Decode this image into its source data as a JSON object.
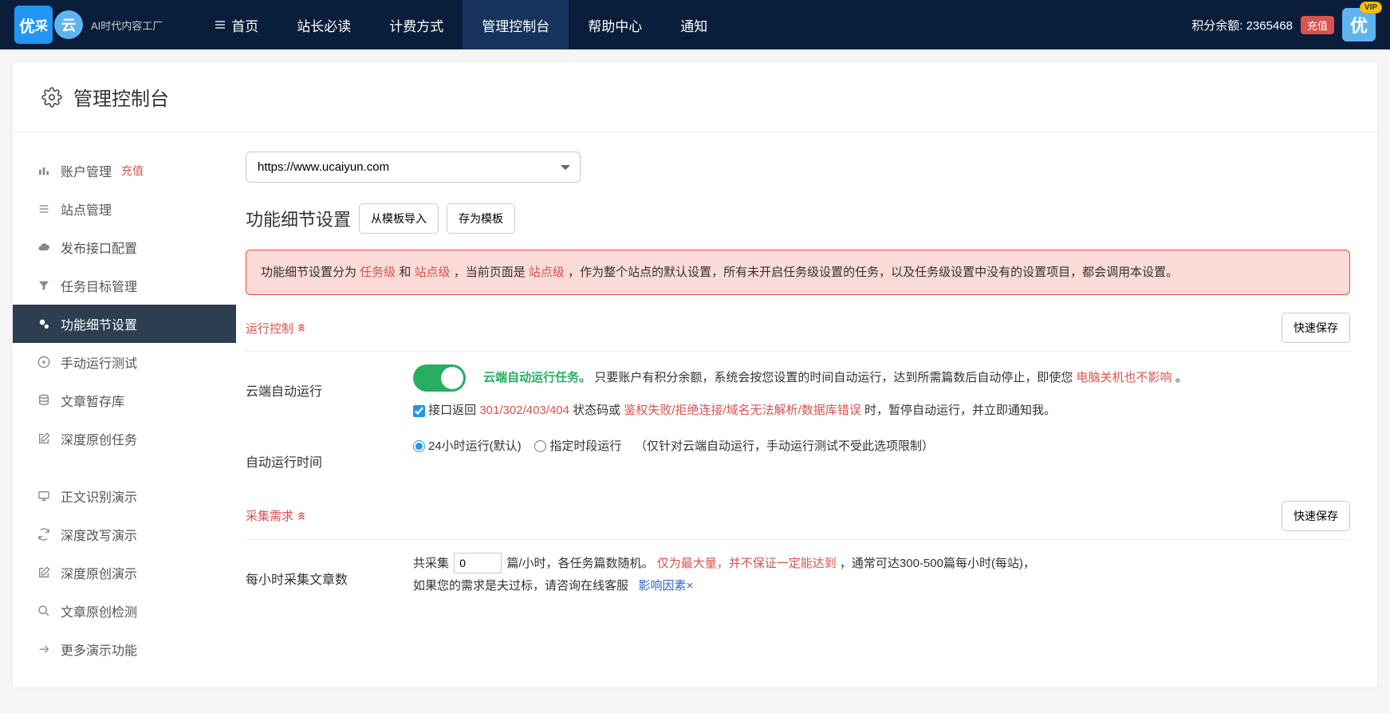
{
  "nav": {
    "logo_main": "优",
    "logo_sub_char": "采",
    "logo_yun": "云",
    "tagline": "AI时代内容工厂",
    "items": [
      {
        "label": "首页",
        "icon": "menu"
      },
      {
        "label": "站长必读"
      },
      {
        "label": "计费方式"
      },
      {
        "label": "管理控制台",
        "active": true
      },
      {
        "label": "帮助中心"
      },
      {
        "label": "通知"
      }
    ],
    "points_label": "积分余额: ",
    "points_value": "2365468",
    "recharge": "充值",
    "user_char": "优",
    "vip": "VIP"
  },
  "panel": {
    "title": "管理控制台"
  },
  "sidebar": {
    "items": [
      {
        "label": "账户管理",
        "badge": "充值",
        "icon": "chart"
      },
      {
        "label": "站点管理",
        "icon": "list"
      },
      {
        "label": "发布接口配置",
        "icon": "cloud"
      },
      {
        "label": "任务目标管理",
        "icon": "filter"
      },
      {
        "label": "功能细节设置",
        "icon": "gears",
        "active": true
      },
      {
        "label": "手动运行测试",
        "icon": "play"
      },
      {
        "label": "文章暂存库",
        "icon": "db"
      },
      {
        "label": "深度原创任务",
        "icon": "edit"
      }
    ],
    "items2": [
      {
        "label": "正文识别演示",
        "icon": "monitor"
      },
      {
        "label": "深度改写演示",
        "icon": "refresh"
      },
      {
        "label": "深度原创演示",
        "icon": "edit"
      },
      {
        "label": "文章原创检测",
        "icon": "search"
      },
      {
        "label": "更多演示功能",
        "icon": "share"
      }
    ]
  },
  "content": {
    "site_selected": "https://www.ucaiyun.com",
    "section_title": "功能细节设置",
    "btn_import": "从模板导入",
    "btn_save_tpl": "存为模板",
    "alert": {
      "p1": "功能细节设置分为 ",
      "lvl1": "任务级",
      "and": " 和 ",
      "lvl2": "站点级",
      "p2": " ，当前页面是 ",
      "lvl3": "站点级",
      "p3": " ，作为整个站点的默认设置，所有未开启任务级设置的任务，以及任务级设置中没有的设置项目，都会调用本设置。"
    },
    "group_run": {
      "title": "运行控制",
      "quick_save": "快速保存",
      "auto_label": "云端自动运行",
      "auto_text1": "云端自动运行任务。",
      "auto_text2": "只要账户有积分余额，系统会按您设置的时间自动运行，达到所需篇数后自动停止，即使您 ",
      "auto_text3": "电脑关机也不影响",
      "auto_text4": " 。",
      "chk_text1": "接口返回 ",
      "chk_codes": "301/302/403/404",
      "chk_text2": " 状态码或 ",
      "chk_errors": "鉴权失败/拒绝连接/域名无法解析/数据库错误",
      "chk_text3": " 时，暂停自动运行，并立即通知我。",
      "time_label": "自动运行时间",
      "time_opt1": "24小时运行(默认)",
      "time_opt2": "指定时段运行",
      "time_note": "（仅针对云端自动运行，手动运行测试不受此选项限制）"
    },
    "group_collect": {
      "title": "采集需求",
      "quick_save": "快速保存",
      "count_label": "每小时采集文章数",
      "c1": "共采集",
      "c_val": "0",
      "c2": "篇/小时，各任务篇数随机。 ",
      "c_red": "仅为最大量，并不保证一定能达到",
      "c3": " ，通常可达300-500篇每小时(每站)，",
      "c4": "如果您的需求是夫过标，请咨询在线客服",
      "c_link": "影响因素×"
    }
  }
}
